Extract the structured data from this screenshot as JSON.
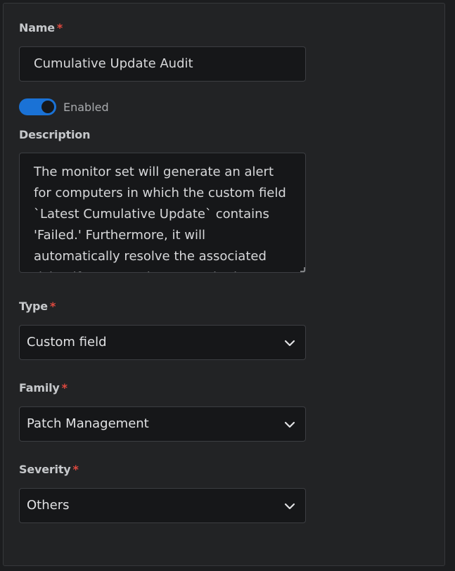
{
  "form": {
    "name": {
      "label": "Name",
      "required_mark": "*",
      "value": "Cumulative Update Audit"
    },
    "enabled_toggle": {
      "label": "Enabled",
      "checked": true,
      "color": "#1a72d6"
    },
    "description": {
      "label": "Description",
      "value": "The monitor set will generate an alert for computers in which the custom field `Latest Cumulative Update` contains 'Failed.' Furthermore, it will automatically resolve the associated ticket if 'Success' is present in the custom field."
    },
    "type": {
      "label": "Type",
      "required_mark": "*",
      "selected": "Custom field",
      "icon": "chevron-down-icon"
    },
    "family": {
      "label": "Family",
      "required_mark": "*",
      "selected": "Patch Management",
      "icon": "chevron-down-icon"
    },
    "severity": {
      "label": "Severity",
      "required_mark": "*",
      "selected": "Others",
      "icon": "chevron-down-icon"
    }
  },
  "colors": {
    "required": "#e0493f",
    "accent": "#1a72d6"
  }
}
